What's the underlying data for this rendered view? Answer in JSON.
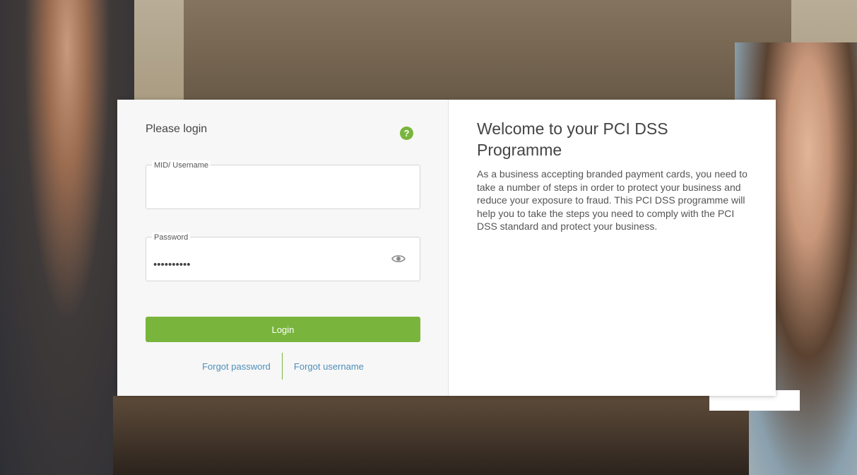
{
  "login": {
    "title": "Please login",
    "help_icon": "?",
    "username": {
      "label": "MID/ Username",
      "value": ""
    },
    "password": {
      "label": "Password",
      "masked_value": "••••••••••"
    },
    "login_button": "Login",
    "forgot_password": "Forgot password",
    "forgot_username": "Forgot username"
  },
  "welcome": {
    "title": "Welcome to your PCI DSS Programme",
    "body": "As a business accepting branded payment cards, you need to take a number of steps in order to protect your business and reduce your exposure to fraud. This PCI DSS programme will help you to take the steps you need to comply with the PCI DSS standard and protect your business."
  },
  "icons": {
    "help": "question-circle-icon",
    "show_password": "eye-icon"
  },
  "colors": {
    "accent_green": "#79b53c",
    "link_blue": "#4e8fb8"
  }
}
